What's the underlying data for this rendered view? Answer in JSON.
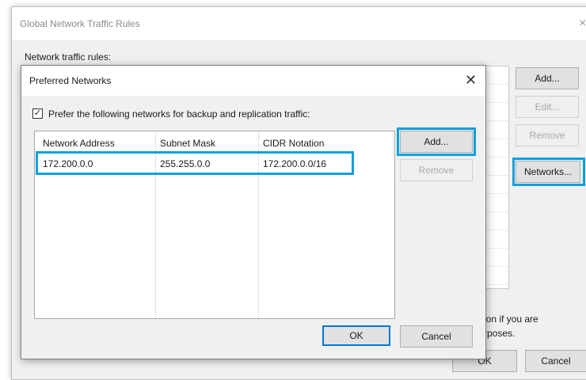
{
  "parent_window": {
    "title": "Global Network Traffic Rules",
    "close_glyph": "×",
    "rules_label": "Network traffic rules:",
    "buttons": {
      "add": "Add...",
      "edit": "Edit...",
      "remove": "Remove",
      "networks": "Networks...",
      "ok": "OK",
      "cancel": "Cancel"
    },
    "note_line1": "ion if you are",
    "note_line2": "rposes."
  },
  "dialog": {
    "title": "Preferred Networks",
    "close_glyph": "✕",
    "checkbox": {
      "checked": true,
      "glyph": "✓",
      "label": "Prefer the following networks for backup and replication traffic:"
    },
    "table": {
      "columns": [
        "Network Address",
        "Subnet Mask",
        "CIDR Notation"
      ],
      "rows": [
        [
          "172.200.0.0",
          "255.255.0.0",
          "172.200.0.0/16"
        ]
      ]
    },
    "buttons": {
      "add": "Add...",
      "remove": "Remove",
      "ok": "OK",
      "cancel": "Cancel"
    }
  },
  "colors": {
    "highlight": "#0aa0e0",
    "focus_border": "#0078d7"
  }
}
